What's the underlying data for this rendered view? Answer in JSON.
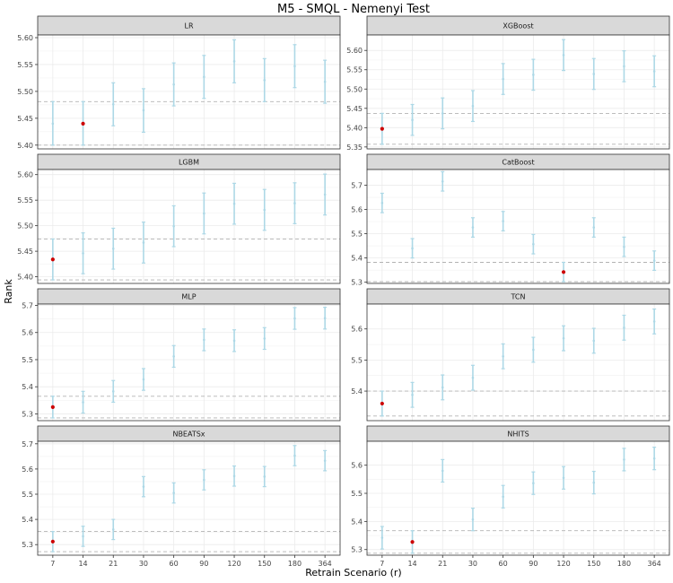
{
  "title": "M5 - SMQL - Nemenyi Test",
  "xlabel": "Retrain Scenario (r)",
  "ylabel": "Rank",
  "colors": {
    "interval": "#add8e6",
    "highlight": "#cc0000",
    "reference_line": "#b3b3b3",
    "strip_fill": "#d9d9d9",
    "panel_border": "#333333",
    "grid": "#ebebeb"
  },
  "chart_data": [
    {
      "type": "errorbar",
      "panel": "LR",
      "categories": [
        "7",
        "14",
        "21",
        "30",
        "60",
        "90",
        "120",
        "150",
        "180",
        "364"
      ],
      "yticks": [
        5.4,
        5.45,
        5.5,
        5.55,
        5.6
      ],
      "ytick_labels": [
        "5.40",
        "5.45",
        "5.50",
        "5.55",
        "5.60"
      ],
      "ylim": [
        5.393,
        5.605
      ],
      "center": [
        5.44,
        5.44,
        5.476,
        5.465,
        5.513,
        5.527,
        5.556,
        5.521,
        5.547,
        5.518
      ],
      "lower": [
        5.4,
        5.4,
        5.436,
        5.424,
        5.473,
        5.487,
        5.516,
        5.481,
        5.507,
        5.478
      ],
      "upper": [
        5.481,
        5.481,
        5.516,
        5.505,
        5.553,
        5.567,
        5.596,
        5.561,
        5.587,
        5.558
      ],
      "best_index": 1,
      "ref_lines": [
        5.4,
        5.481
      ]
    },
    {
      "type": "errorbar",
      "panel": "XGBoost",
      "categories": [
        "7",
        "14",
        "21",
        "30",
        "60",
        "90",
        "120",
        "150",
        "180",
        "364"
      ],
      "yticks": [
        5.35,
        5.4,
        5.45,
        5.5,
        5.55,
        5.6
      ],
      "ytick_labels": [
        "5.35",
        "5.40",
        "5.45",
        "5.50",
        "5.55",
        "5.60"
      ],
      "ylim": [
        5.345,
        5.64
      ],
      "center": [
        5.397,
        5.42,
        5.437,
        5.456,
        5.526,
        5.537,
        5.588,
        5.539,
        5.559,
        5.546
      ],
      "lower": [
        5.357,
        5.38,
        5.397,
        5.416,
        5.486,
        5.497,
        5.548,
        5.499,
        5.519,
        5.506
      ],
      "upper": [
        5.437,
        5.46,
        5.477,
        5.496,
        5.566,
        5.577,
        5.628,
        5.579,
        5.599,
        5.586
      ],
      "best_index": 0,
      "ref_lines": [
        5.357,
        5.437
      ]
    },
    {
      "type": "errorbar",
      "panel": "LGBM",
      "categories": [
        "7",
        "14",
        "21",
        "30",
        "60",
        "90",
        "120",
        "150",
        "180",
        "364"
      ],
      "yticks": [
        5.4,
        5.45,
        5.5,
        5.55,
        5.6
      ],
      "ytick_labels": [
        "5.40",
        "5.45",
        "5.50",
        "5.55",
        "5.60"
      ],
      "ylim": [
        5.387,
        5.61
      ],
      "center": [
        5.434,
        5.446,
        5.455,
        5.467,
        5.499,
        5.524,
        5.543,
        5.531,
        5.544,
        5.561
      ],
      "lower": [
        5.394,
        5.406,
        5.415,
        5.427,
        5.459,
        5.484,
        5.503,
        5.491,
        5.504,
        5.521
      ],
      "upper": [
        5.474,
        5.486,
        5.495,
        5.507,
        5.539,
        5.564,
        5.583,
        5.571,
        5.584,
        5.601
      ],
      "best_index": 0,
      "ref_lines": [
        5.394,
        5.474
      ]
    },
    {
      "type": "errorbar",
      "panel": "CatBoost",
      "categories": [
        "7",
        "14",
        "21",
        "30",
        "60",
        "90",
        "120",
        "150",
        "180",
        "364"
      ],
      "yticks": [
        5.3,
        5.4,
        5.5,
        5.6,
        5.7
      ],
      "ytick_labels": [
        "5.3",
        "5.4",
        "5.5",
        "5.6",
        "5.7"
      ],
      "ylim": [
        5.295,
        5.765
      ],
      "center": [
        5.627,
        5.44,
        5.716,
        5.526,
        5.552,
        5.457,
        5.342,
        5.526,
        5.446,
        5.389
      ],
      "lower": [
        5.587,
        5.4,
        5.676,
        5.486,
        5.512,
        5.417,
        5.302,
        5.486,
        5.406,
        5.349
      ],
      "upper": [
        5.667,
        5.48,
        5.756,
        5.566,
        5.592,
        5.497,
        5.382,
        5.566,
        5.486,
        5.429
      ],
      "best_index": 6,
      "ref_lines": [
        5.302,
        5.382
      ]
    },
    {
      "type": "errorbar",
      "panel": "MLP",
      "categories": [
        "7",
        "14",
        "21",
        "30",
        "60",
        "90",
        "120",
        "150",
        "180",
        "364"
      ],
      "yticks": [
        5.3,
        5.4,
        5.5,
        5.6,
        5.7
      ],
      "ytick_labels": [
        "5.3",
        "5.4",
        "5.5",
        "5.6",
        "5.7"
      ],
      "ylim": [
        5.275,
        5.705
      ],
      "center": [
        5.325,
        5.343,
        5.383,
        5.427,
        5.512,
        5.573,
        5.57,
        5.578,
        5.652,
        5.653
      ],
      "lower": [
        5.285,
        5.303,
        5.343,
        5.387,
        5.472,
        5.533,
        5.53,
        5.538,
        5.612,
        5.613
      ],
      "upper": [
        5.365,
        5.383,
        5.423,
        5.467,
        5.552,
        5.613,
        5.61,
        5.618,
        5.692,
        5.693
      ],
      "best_index": 0,
      "ref_lines": [
        5.285,
        5.365
      ]
    },
    {
      "type": "errorbar",
      "panel": "TCN",
      "categories": [
        "7",
        "14",
        "21",
        "30",
        "60",
        "90",
        "120",
        "150",
        "180",
        "364"
      ],
      "yticks": [
        5.4,
        5.5,
        5.6
      ],
      "ytick_labels": [
        "5.4",
        "5.5",
        "5.6"
      ],
      "ylim": [
        5.305,
        5.68
      ],
      "center": [
        5.36,
        5.388,
        5.412,
        5.443,
        5.512,
        5.533,
        5.57,
        5.562,
        5.604,
        5.624
      ],
      "lower": [
        5.32,
        5.348,
        5.372,
        5.403,
        5.472,
        5.493,
        5.53,
        5.522,
        5.564,
        5.584
      ],
      "upper": [
        5.4,
        5.428,
        5.452,
        5.483,
        5.552,
        5.573,
        5.61,
        5.602,
        5.644,
        5.664
      ],
      "best_index": 0,
      "ref_lines": [
        5.32,
        5.4
      ]
    },
    {
      "type": "errorbar",
      "panel": "NBEATSx",
      "categories": [
        "7",
        "14",
        "21",
        "30",
        "60",
        "90",
        "120",
        "150",
        "180",
        "364"
      ],
      "yticks": [
        5.3,
        5.4,
        5.5,
        5.6,
        5.7
      ],
      "ytick_labels": [
        "5.3",
        "5.4",
        "5.5",
        "5.6",
        "5.7"
      ],
      "ylim": [
        5.258,
        5.71
      ],
      "center": [
        5.312,
        5.333,
        5.36,
        5.53,
        5.505,
        5.557,
        5.572,
        5.57,
        5.653,
        5.633
      ],
      "lower": [
        5.272,
        5.293,
        5.32,
        5.49,
        5.465,
        5.517,
        5.532,
        5.53,
        5.613,
        5.593
      ],
      "upper": [
        5.352,
        5.373,
        5.4,
        5.57,
        5.545,
        5.597,
        5.612,
        5.61,
        5.693,
        5.673
      ],
      "best_index": 0,
      "ref_lines": [
        5.272,
        5.352
      ]
    },
    {
      "type": "errorbar",
      "panel": "NHITS",
      "categories": [
        "7",
        "14",
        "21",
        "30",
        "60",
        "90",
        "120",
        "150",
        "180",
        "364"
      ],
      "yticks": [
        5.3,
        5.4,
        5.5,
        5.6
      ],
      "ytick_labels": [
        "5.3",
        "5.4",
        "5.5",
        "5.6"
      ],
      "ylim": [
        5.28,
        5.685
      ],
      "center": [
        5.342,
        5.327,
        5.58,
        5.407,
        5.488,
        5.536,
        5.555,
        5.538,
        5.62,
        5.624
      ],
      "lower": [
        5.302,
        5.287,
        5.54,
        5.367,
        5.448,
        5.496,
        5.515,
        5.498,
        5.58,
        5.584
      ],
      "upper": [
        5.382,
        5.367,
        5.62,
        5.447,
        5.528,
        5.576,
        5.595,
        5.578,
        5.66,
        5.664
      ],
      "best_index": 1,
      "ref_lines": [
        5.287,
        5.367
      ]
    }
  ]
}
